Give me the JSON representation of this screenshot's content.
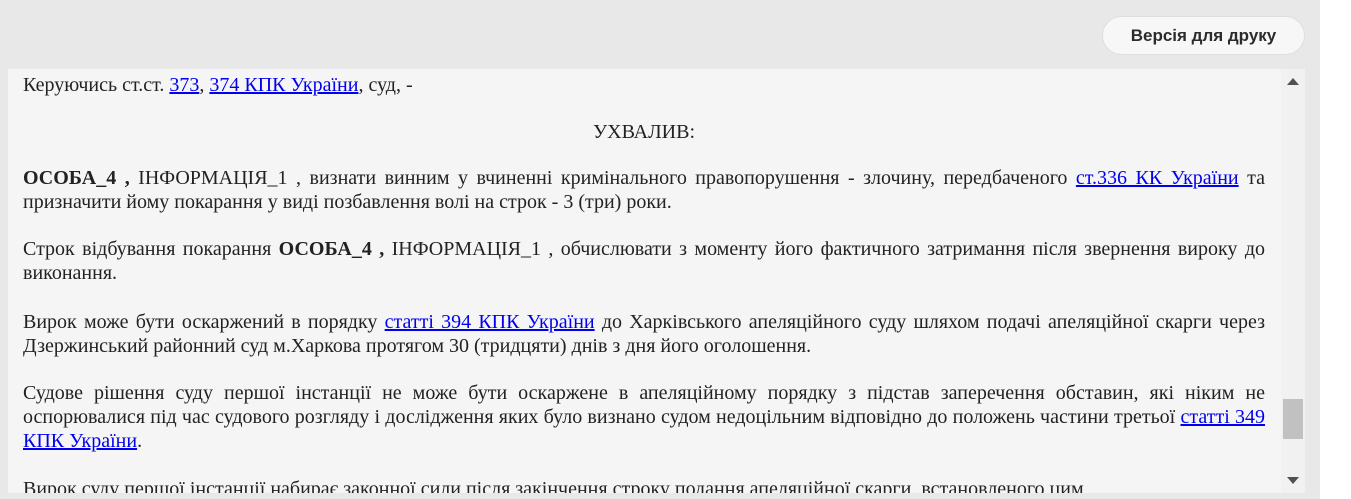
{
  "toolbar": {
    "print_label": "Версія для друку"
  },
  "doc": {
    "p1": {
      "pre": "Керуючись ст.ст. ",
      "link1": "373",
      "sep": ", ",
      "link2": "374 КПК України",
      "post": ", суд, -"
    },
    "heading": "УХВАЛИВ:",
    "p2": {
      "bold": "ОСОБА_4 ,",
      "mid": " ІНФОРМАЦІЯ_1 , визнати винним у вчиненні кримінального правопорушення - злочину, передбаченого ",
      "link": "ст.336 КК України",
      "post": " та призначити йому покарання у виді позбавлення волі на строк - 3 (три) роки."
    },
    "p3": {
      "pre": "Строк відбування покарання ",
      "bold": "ОСОБА_4 ,",
      "post": " ІНФОРМАЦІЯ_1 , обчислювати з моменту його фактичного затримання після звернення вироку до виконання."
    },
    "p4": {
      "pre": "Вирок може бути оскаржений в порядку ",
      "link": "статті 394 КПК України",
      "post": " до Харківського апеляційного суду шляхом подачі апеляційної скарги через Дзержинський районний суд м.Харкова протягом 30 (тридцяти) днів з дня його оголошення."
    },
    "p5": {
      "pre": "Судове рішення суду першої інстанції не може бути оскаржене в апеляційному порядку з підстав заперечення обставин, які ніким не оспорювалися під час судового розгляду і дослідження яких було визнано судом недоцільним відповідно до положень частини третьої ",
      "link": "статті 349 КПК України",
      "post": "."
    },
    "p6": {
      "text": "Вирок суду першої інстанції набирає законної сили після закінчення строку подання апеляційної скарги, встановленого цим"
    }
  },
  "scroll": {
    "position_fraction": 0.9
  }
}
